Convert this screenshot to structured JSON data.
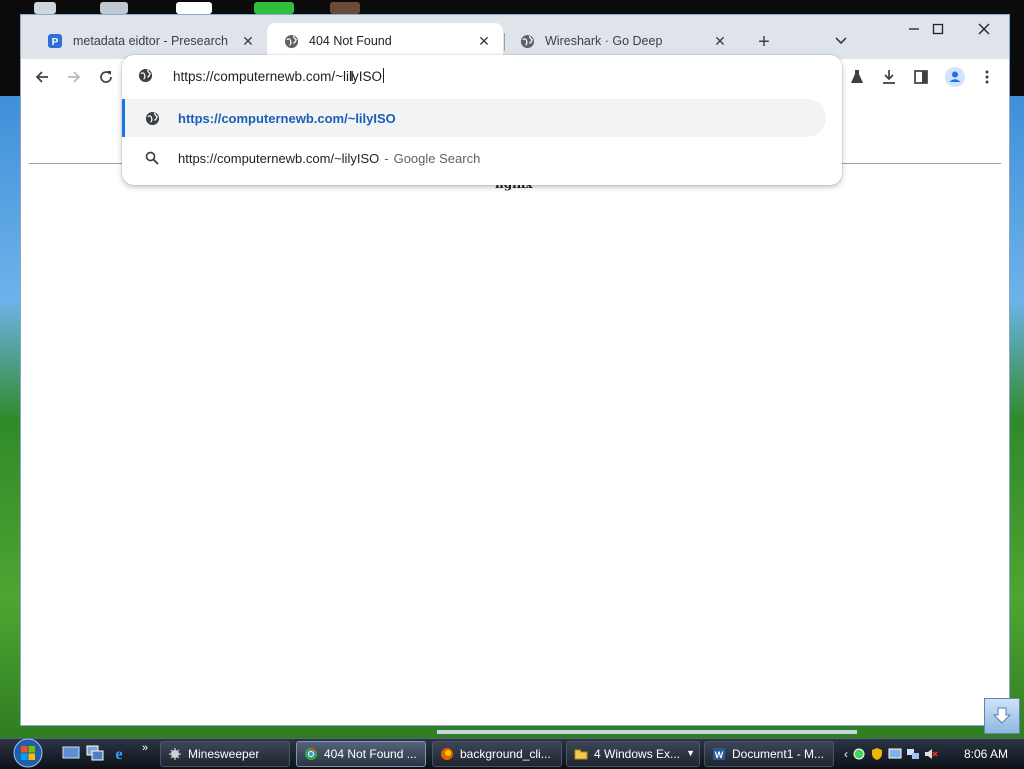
{
  "browser": {
    "tabs": [
      {
        "title": "metadata eidtor - Presearch",
        "icon": "presearch-icon",
        "active": false
      },
      {
        "title": "404 Not Found",
        "icon": "globe-icon",
        "active": true
      },
      {
        "title": "Wireshark · Go Deep",
        "icon": "globe-icon",
        "active": false
      }
    ],
    "omnibox": {
      "value": "https://computernewb.com/~lilyISO",
      "suggestions": [
        {
          "text": "https://computernewb.com/~lilyISO",
          "icon": "globe-icon",
          "selected": true
        },
        {
          "text": "https://computernewb.com/~lilyISO",
          "suffix": "Google Search",
          "separator": "-",
          "icon": "search-icon",
          "selected": false
        }
      ]
    },
    "page": {
      "partial_text": "nginx"
    }
  },
  "taskbar": {
    "tasks": [
      {
        "label": "Minesweeper",
        "icon": "minesweeper-icon"
      },
      {
        "label": "404 Not Found ...",
        "icon": "chrome-icon"
      },
      {
        "label": "background_cli...",
        "icon": "firefox-icon"
      },
      {
        "label": "4 Windows Ex...",
        "icon": "folder-icon"
      },
      {
        "label": "Document1 - M...",
        "icon": "word-icon"
      }
    ],
    "clock": "8:06 AM"
  },
  "colors": {
    "accent": "#1a73e8",
    "suggestion_link": "#1a5fb4",
    "tabstrip": "#dfe4ea"
  }
}
